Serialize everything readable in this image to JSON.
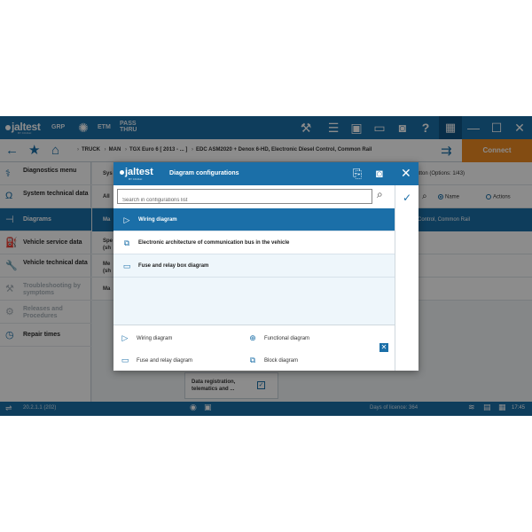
{
  "app": {
    "logo": "jaltest",
    "logo_sub": "BY COJALI",
    "toolbar": {
      "grp": "GRP",
      "etm": "ETM",
      "pass_thru": "PASS THRU"
    },
    "connect_label": "Connect"
  },
  "breadcrumb": {
    "items": [
      "TRUCK",
      "MAN",
      "TGX Euro 6 [ 2013 - ... ]",
      "EDC ASM2020 + Denox 6-HD, Electronic Diesel Control, Common Rail"
    ]
  },
  "sidebar": {
    "items": [
      {
        "label": "Diagnostics menu",
        "state": "normal"
      },
      {
        "label": "System technical data",
        "state": "normal"
      },
      {
        "label": "Diagrams",
        "state": "active"
      },
      {
        "label": "Vehicle service data",
        "state": "normal"
      },
      {
        "label": "Vehicle technical data",
        "state": "normal"
      },
      {
        "label": "Troubleshooting by symptoms",
        "state": "disabled"
      },
      {
        "label": "Releases and Procedures",
        "state": "disabled"
      },
      {
        "label": "Repair times",
        "state": "normal"
      }
    ]
  },
  "background": {
    "row1_left": "Sys",
    "row1_right": "button (Options: 1/43)",
    "row2_left": "All",
    "radio_name": "Name",
    "radio_actions": "Actions",
    "row3_left": "Ma",
    "row3_right": "Control, Common Rail",
    "row4_left": "Spe (sh",
    "row5_left": "Me (sh",
    "row6_left": "Ma",
    "card_label": "Data registration, telematics and ..."
  },
  "modal": {
    "logo": "jaltest",
    "logo_sub": "BY COJALI",
    "title": "Diagram configurations",
    "search_placeholder": "Search in configurations list",
    "items": [
      {
        "label": "Wiring diagram",
        "icon": "wiring-diagram-icon",
        "selected": true
      },
      {
        "label": "Electronic architecture of communication bus in the vehicle",
        "icon": "block-diagram-icon",
        "selected": false
      },
      {
        "label": "Fuse and relay box diagram",
        "icon": "fuse-icon",
        "selected": false
      }
    ],
    "legend": {
      "wiring": "Wiring diagram",
      "functional": "Functional diagram",
      "fuse": "Fuse and relay diagram",
      "block": "Block diagram"
    }
  },
  "statusbar": {
    "version": "20.2.1.1 (202)",
    "licence": "Days of licence: 364",
    "time": "17:45"
  },
  "colors": {
    "primary": "#1b6fa8",
    "accent": "#ef8a22",
    "selected_row": "#1b6fa8"
  }
}
